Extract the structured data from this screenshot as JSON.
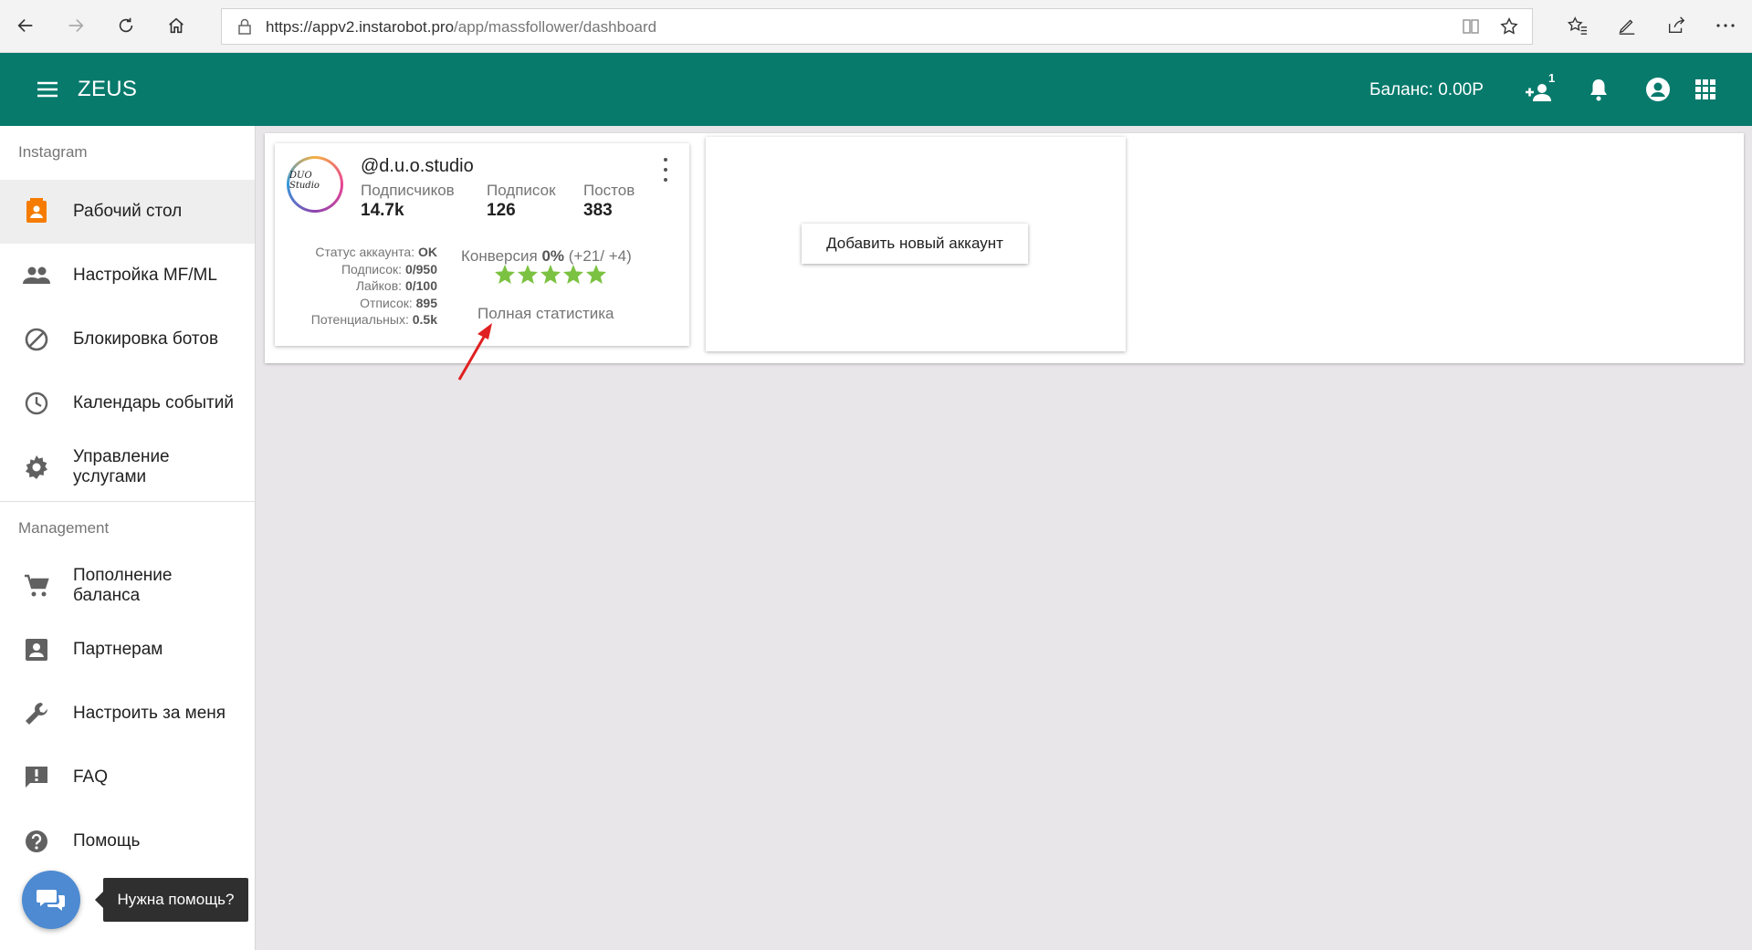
{
  "browser": {
    "url_host": "https://appv2.instarobot.pro",
    "url_path": "/app/massfollower/dashboard"
  },
  "header": {
    "brand": "ZEUS",
    "balance": "Баланс: 0.00P",
    "add_user_badge": "1"
  },
  "sidebar": {
    "section_instagram": "Instagram",
    "section_management": "Management",
    "items": [
      {
        "label": "Рабочий стол",
        "icon": "dashboard-icon"
      },
      {
        "label": "Настройка MF/ML",
        "icon": "people-icon"
      },
      {
        "label": "Блокировка ботов",
        "icon": "block-icon"
      },
      {
        "label": "Календарь событий",
        "icon": "clock-icon"
      },
      {
        "label": "Управление услугами",
        "icon": "gear-icon"
      },
      {
        "label": "Пополнение баланса",
        "icon": "cart-icon"
      },
      {
        "label": "Партнерам",
        "icon": "contact-icon"
      },
      {
        "label": "Настроить за меня",
        "icon": "wrench-icon"
      },
      {
        "label": "FAQ",
        "icon": "feedback-icon"
      },
      {
        "label": "Помощь",
        "icon": "help-icon"
      }
    ]
  },
  "account": {
    "avatar_text": "DUO Studio",
    "handle": "@d.u.o.studio",
    "followers_label": "Подписчиков",
    "followers": "14.7k",
    "following_label": "Подписок",
    "following": "126",
    "posts_label": "Постов",
    "posts": "383",
    "status_label": "Статус аккаунта:",
    "status": "OK",
    "follows_label": "Подписок:",
    "follows": "0/950",
    "likes_label": "Лайков:",
    "likes": "0/100",
    "unfollows_label": "Отписок:",
    "unfollows": "895",
    "potential_label": "Потенциальных:",
    "potential": "0.5k",
    "conversion_label": "Конверсия",
    "conversion": "0%",
    "conversion_delta": "(+21/ +4)",
    "rating": 5,
    "full_stats": "Полная статистика"
  },
  "add_account_label": "Добавить новый аккаунт",
  "chat": {
    "tooltip": "Нужна помощь?"
  },
  "colors": {
    "primary": "#077a6c",
    "accent": "#f57c00",
    "star": "#7cc242",
    "chat": "#4d8ad1"
  }
}
